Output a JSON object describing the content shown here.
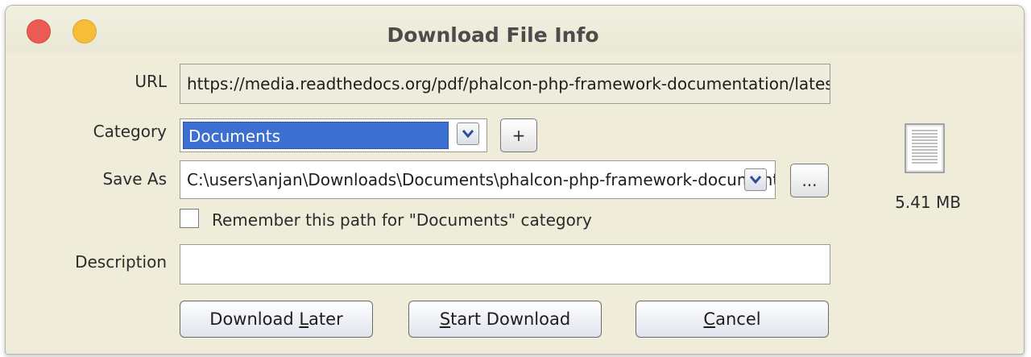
{
  "window": {
    "title": "Download File Info"
  },
  "url": {
    "label": "URL",
    "value": "https://media.readthedocs.org/pdf/phalcon-php-framework-documentation/latest/phalcon-php-framework-documentation.pdf"
  },
  "category": {
    "label": "Category",
    "selected": "Documents",
    "add_label": "+"
  },
  "save_as": {
    "label": "Save As",
    "value": "C:\\users\\anjan\\Downloads\\Documents\\phalcon-php-framework-documentation.pdf",
    "browse_label": "..."
  },
  "remember": {
    "label": "Remember this path for \"Documents\" category",
    "checked": false
  },
  "description": {
    "label": "Description",
    "value": ""
  },
  "file": {
    "size": "5.41  MB",
    "icon": "document-icon"
  },
  "buttons": {
    "download_later_prefix": "Download ",
    "download_later_mnemonic": "L",
    "download_later_suffix": "ater",
    "start_mnemonic": "S",
    "start_suffix": "tart Download",
    "cancel_mnemonic": "C",
    "cancel_suffix": "ancel"
  },
  "colors": {
    "window_bg": "#efedda",
    "selection": "#3b6fd0",
    "close": "#ec5a54",
    "minimize": "#f5bd3a"
  }
}
